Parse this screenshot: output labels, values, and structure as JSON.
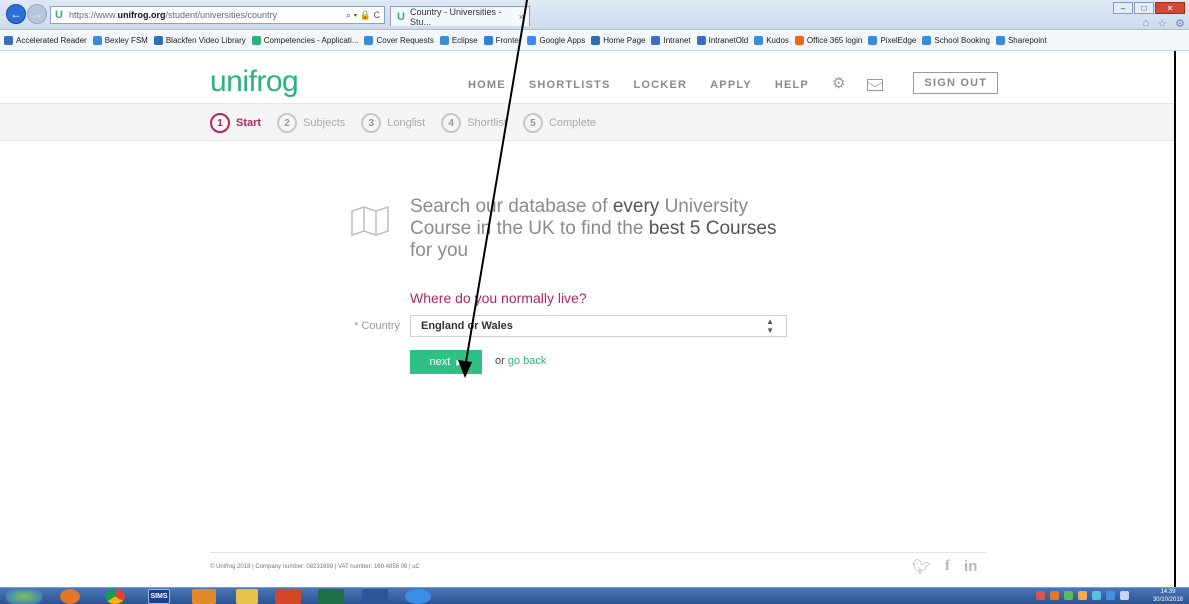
{
  "browser": {
    "url_prefix": "https://www.",
    "url_domain": "unifrog.org",
    "url_path": "/student/universities/country",
    "address_icons": "⌕ ▾ 🔒 C",
    "tab_title": "Country - Universities - Stu...",
    "tab_close": "×"
  },
  "favorites": [
    {
      "label": "Accelerated Reader",
      "color": "#3a6fc0"
    },
    {
      "label": "Bexley FSM",
      "color": "#3b8bd6"
    },
    {
      "label": "Blackfen Video Library",
      "color": "#2f6db5"
    },
    {
      "label": "Competencies - Applicati...",
      "color": "#2db37a"
    },
    {
      "label": "Cover Requests",
      "color": "#3b8bd6"
    },
    {
      "label": "Eclipse",
      "color": "#3b8bd6"
    },
    {
      "label": "Fronter",
      "color": "#2f7fd8"
    },
    {
      "label": "Google Apps",
      "color": "#4285f4"
    },
    {
      "label": "Home Page",
      "color": "#2f6db5"
    },
    {
      "label": "Intranet",
      "color": "#3a6fc0"
    },
    {
      "label": "IntranetOld",
      "color": "#3a6fc0"
    },
    {
      "label": "Kudos",
      "color": "#3b8bd6"
    },
    {
      "label": "Office 365 login",
      "color": "#e8691a"
    },
    {
      "label": "PixelEdge",
      "color": "#3b8bd6"
    },
    {
      "label": "School Booking",
      "color": "#3b8bd6"
    },
    {
      "label": "Sharepoint",
      "color": "#3b8bd6"
    }
  ],
  "site": {
    "logo": "unifrog",
    "nav": [
      "HOME",
      "SHORTLISTS",
      "LOCKER",
      "APPLY",
      "HELP"
    ],
    "sign_out": "SIGN OUT"
  },
  "steps": [
    {
      "num": "1",
      "label": "Start"
    },
    {
      "num": "2",
      "label": "Subjects"
    },
    {
      "num": "3",
      "label": "Longlist"
    },
    {
      "num": "4",
      "label": "Shortlist"
    },
    {
      "num": "5",
      "label": "Complete"
    }
  ],
  "main": {
    "headline_1": "Search our database of ",
    "headline_2": "every",
    "headline_3": "University Course in the UK to find the ",
    "headline_4": "best 5 Courses",
    "headline_5": " for you",
    "question": "Where do you normally live?",
    "country_label": "* Country",
    "country_value": "England or Wales",
    "next_label": "next",
    "or_text": "or ",
    "go_back": "go back"
  },
  "footer": {
    "text": "© Unifrog 2018 | Company number: 08231699 | VAT number: 160 4858 06 | uC",
    "social": [
      "twitter-icon",
      "facebook-icon",
      "linkedin-icon"
    ]
  },
  "taskbar": {
    "sims_label": "SIMS",
    "clock_time": "14:39",
    "clock_date": "30/10/2018"
  },
  "colors": {
    "brand_green": "#2db37a",
    "accent_magenta": "#b0265e",
    "button_green": "#2ec085"
  }
}
